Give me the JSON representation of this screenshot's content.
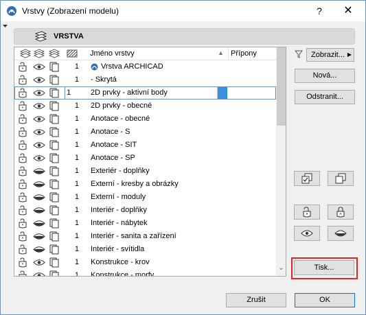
{
  "window": {
    "title": "Vrstvy (Zobrazení modelu)",
    "help_label": "?",
    "close_label": "✕"
  },
  "section_header": {
    "label": "VRSTVA"
  },
  "list": {
    "columns": {
      "name": "Jméno vrstvy",
      "extensions": "Přípony"
    },
    "rows": [
      {
        "lock": "unlocked",
        "eye": "open",
        "num": "1",
        "name": "Vrstva ARCHICAD",
        "archicad": true
      },
      {
        "lock": "unlocked",
        "eye": "open",
        "num": "1",
        "name": "- Skrytá"
      },
      {
        "lock": "unlocked",
        "eye": "open",
        "num": "1",
        "name": "2D prvky - aktivní body",
        "selected": true
      },
      {
        "lock": "unlocked",
        "eye": "open",
        "num": "1",
        "name": "2D prvky - obecné"
      },
      {
        "lock": "unlocked",
        "eye": "open",
        "num": "1",
        "name": "Anotace - obecné"
      },
      {
        "lock": "unlocked",
        "eye": "open",
        "num": "1",
        "name": "Anotace - S"
      },
      {
        "lock": "unlocked",
        "eye": "open",
        "num": "1",
        "name": "Anotace - SIT"
      },
      {
        "lock": "unlocked",
        "eye": "open",
        "num": "1",
        "name": "Anotace - SP"
      },
      {
        "lock": "unlocked",
        "eye": "closed",
        "num": "1",
        "name": "Exteriér - doplňky"
      },
      {
        "lock": "unlocked",
        "eye": "closed",
        "num": "1",
        "name": "Externí - kresby a obrázky"
      },
      {
        "lock": "unlocked",
        "eye": "closed",
        "num": "1",
        "name": "Externí - moduly"
      },
      {
        "lock": "unlocked",
        "eye": "closed",
        "num": "1",
        "name": "Interiér - doplňky"
      },
      {
        "lock": "unlocked",
        "eye": "closed",
        "num": "1",
        "name": "Interiér - nábytek"
      },
      {
        "lock": "unlocked",
        "eye": "closed",
        "num": "1",
        "name": "Interiér - sanita a zařízení"
      },
      {
        "lock": "unlocked",
        "eye": "closed",
        "num": "1",
        "name": "Interiér - svítidla"
      },
      {
        "lock": "unlocked",
        "eye": "open",
        "num": "1",
        "name": "Konstrukce - krov"
      },
      {
        "lock": "unlocked",
        "eye": "open",
        "num": "1",
        "name": "Konstrukce - morfy"
      }
    ]
  },
  "buttons": {
    "show": "Zobrazit...",
    "new": "Nová...",
    "delete": "Odstranit...",
    "print": "Tisk...",
    "cancel": "Zrušit",
    "ok": "OK"
  },
  "colors": {
    "accent": "#0078d7",
    "selection_frame": "#6a8fbf",
    "highlight": "#e8202a"
  }
}
